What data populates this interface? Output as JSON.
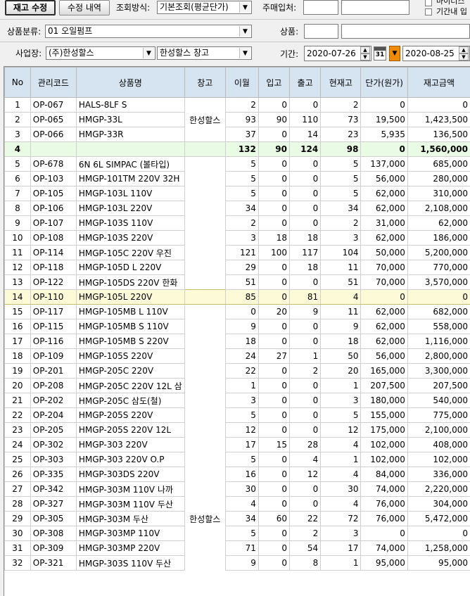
{
  "toolbar": {
    "stock_adjust_label": "재고 수정",
    "edit_history_label": "수정 내역",
    "query_method_label": "조회방식:",
    "query_method_value": "기본조회(평균단가)",
    "main_vendor_label": "주매입처:",
    "my_item_label": "마이너스",
    "period_label_chk": "기간내 입"
  },
  "filters": {
    "category_label": "상품분류:",
    "category_value": "01 오일펌프",
    "product_label": "상품:",
    "business_label": "사업장:",
    "business_value": "(주)한성할스",
    "warehouse_value": "한성할스 창고",
    "period_label": "기간:",
    "date_from": "2020-07-26",
    "date_to": "2020-08-25",
    "calendar_text": "31"
  },
  "grid": {
    "columns": [
      "No",
      "관리코드",
      "상품명",
      "창고",
      "이월",
      "입고",
      "출고",
      "현재고",
      "단가(원가)",
      "재고금액"
    ],
    "group1_warehouse": "한성할스",
    "group2_warehouse": "한성할스",
    "rows": [
      {
        "no": "1",
        "code": "OP-067",
        "name": "HALS-8LF S",
        "carry": "2",
        "in": "0",
        "out": "0",
        "stock": "2",
        "price": "0",
        "amount": "0"
      },
      {
        "no": "2",
        "code": "OP-065",
        "name": "HMGP-33L",
        "carry": "93",
        "in": "90",
        "out": "110",
        "stock": "73",
        "price": "19,500",
        "amount": "1,423,500"
      },
      {
        "no": "3",
        "code": "OP-066",
        "name": "HMGP-33R",
        "carry": "37",
        "in": "0",
        "out": "14",
        "stock": "23",
        "price": "5,935",
        "amount": "136,500"
      },
      {
        "no": "4",
        "code": "",
        "name": "",
        "carry": "132",
        "in": "90",
        "out": "124",
        "stock": "98",
        "price": "0",
        "amount": "1,560,000"
      },
      {
        "no": "5",
        "code": "OP-678",
        "name": "6N 6L SIMPAC (볼타입)",
        "carry": "5",
        "in": "0",
        "out": "0",
        "stock": "5",
        "price": "137,000",
        "amount": "685,000"
      },
      {
        "no": "6",
        "code": "OP-103",
        "name": "HMGP-101TM 220V 32H",
        "carry": "5",
        "in": "0",
        "out": "0",
        "stock": "5",
        "price": "56,000",
        "amount": "280,000"
      },
      {
        "no": "7",
        "code": "OP-105",
        "name": "HMGP-103L 110V",
        "carry": "5",
        "in": "0",
        "out": "0",
        "stock": "5",
        "price": "62,000",
        "amount": "310,000"
      },
      {
        "no": "8",
        "code": "OP-106",
        "name": "HMGP-103L 220V",
        "carry": "34",
        "in": "0",
        "out": "0",
        "stock": "34",
        "price": "62,000",
        "amount": "2,108,000"
      },
      {
        "no": "9",
        "code": "OP-107",
        "name": "HMGP-103S 110V",
        "carry": "2",
        "in": "0",
        "out": "0",
        "stock": "2",
        "price": "31,000",
        "amount": "62,000"
      },
      {
        "no": "10",
        "code": "OP-108",
        "name": "HMGP-103S 220V",
        "carry": "3",
        "in": "18",
        "out": "18",
        "stock": "3",
        "price": "62,000",
        "amount": "186,000"
      },
      {
        "no": "11",
        "code": "OP-114",
        "name": "HMGP-105C 220V 우진",
        "carry": "121",
        "in": "100",
        "out": "117",
        "stock": "104",
        "price": "50,000",
        "amount": "5,200,000"
      },
      {
        "no": "12",
        "code": "OP-118",
        "name": "HMGP-105D L 220V",
        "carry": "29",
        "in": "0",
        "out": "18",
        "stock": "11",
        "price": "70,000",
        "amount": "770,000"
      },
      {
        "no": "13",
        "code": "OP-122",
        "name": "HMGP-105DS 220V 한화",
        "carry": "51",
        "in": "0",
        "out": "0",
        "stock": "51",
        "price": "70,000",
        "amount": "3,570,000"
      },
      {
        "no": "14",
        "code": "OP-110",
        "name": "HMGP-105L 220V",
        "carry": "85",
        "in": "0",
        "out": "81",
        "stock": "4",
        "price": "0",
        "amount": "0"
      },
      {
        "no": "15",
        "code": "OP-117",
        "name": "HMGP-105MB L 110V",
        "carry": "0",
        "in": "20",
        "out": "9",
        "stock": "11",
        "price": "62,000",
        "amount": "682,000"
      },
      {
        "no": "16",
        "code": "OP-115",
        "name": "HMGP-105MB S 110V",
        "carry": "9",
        "in": "0",
        "out": "0",
        "stock": "9",
        "price": "62,000",
        "amount": "558,000"
      },
      {
        "no": "17",
        "code": "OP-116",
        "name": "HMGP-105MB S 220V",
        "carry": "18",
        "in": "0",
        "out": "0",
        "stock": "18",
        "price": "62,000",
        "amount": "1,116,000"
      },
      {
        "no": "18",
        "code": "OP-109",
        "name": "HMGP-105S 220V",
        "carry": "24",
        "in": "27",
        "out": "1",
        "stock": "50",
        "price": "56,000",
        "amount": "2,800,000"
      },
      {
        "no": "19",
        "code": "OP-201",
        "name": "HMGP-205C 220V",
        "carry": "22",
        "in": "0",
        "out": "2",
        "stock": "20",
        "price": "165,000",
        "amount": "3,300,000"
      },
      {
        "no": "20",
        "code": "OP-208",
        "name": "HMGP-205C 220V 12L 삼",
        "carry": "1",
        "in": "0",
        "out": "0",
        "stock": "1",
        "price": "207,500",
        "amount": "207,500"
      },
      {
        "no": "21",
        "code": "OP-202",
        "name": "HMGP-205C 삼도(철)",
        "carry": "3",
        "in": "0",
        "out": "0",
        "stock": "3",
        "price": "180,000",
        "amount": "540,000"
      },
      {
        "no": "22",
        "code": "OP-204",
        "name": "HMGP-205S 220V",
        "carry": "5",
        "in": "0",
        "out": "0",
        "stock": "5",
        "price": "155,000",
        "amount": "775,000"
      },
      {
        "no": "23",
        "code": "OP-205",
        "name": "HMGP-205S 220V 12L",
        "carry": "12",
        "in": "0",
        "out": "0",
        "stock": "12",
        "price": "175,000",
        "amount": "2,100,000"
      },
      {
        "no": "24",
        "code": "OP-302",
        "name": "HMGP-303 220V",
        "carry": "17",
        "in": "15",
        "out": "28",
        "stock": "4",
        "price": "102,000",
        "amount": "408,000"
      },
      {
        "no": "25",
        "code": "OP-303",
        "name": "HMGP-303 220V O.P",
        "carry": "5",
        "in": "0",
        "out": "4",
        "stock": "1",
        "price": "102,000",
        "amount": "102,000"
      },
      {
        "no": "26",
        "code": "OP-335",
        "name": "HMGP-303DS 220V",
        "carry": "16",
        "in": "0",
        "out": "12",
        "stock": "4",
        "price": "84,000",
        "amount": "336,000"
      },
      {
        "no": "27",
        "code": "OP-342",
        "name": "HMGP-303M 110V 나까",
        "carry": "30",
        "in": "0",
        "out": "0",
        "stock": "30",
        "price": "74,000",
        "amount": "2,220,000"
      },
      {
        "no": "28",
        "code": "OP-327",
        "name": "HMGP-303M 110V 두산",
        "carry": "4",
        "in": "0",
        "out": "0",
        "stock": "4",
        "price": "76,000",
        "amount": "304,000"
      },
      {
        "no": "29",
        "code": "OP-305",
        "name": "HMGP-303M 두산",
        "carry": "34",
        "in": "60",
        "out": "22",
        "stock": "72",
        "price": "76,000",
        "amount": "5,472,000"
      },
      {
        "no": "30",
        "code": "OP-308",
        "name": "HMGP-303MP 110V",
        "carry": "5",
        "in": "0",
        "out": "2",
        "stock": "3",
        "price": "0",
        "amount": "0"
      },
      {
        "no": "31",
        "code": "OP-309",
        "name": "HMGP-303MP 220V",
        "carry": "71",
        "in": "0",
        "out": "54",
        "stock": "17",
        "price": "74,000",
        "amount": "1,258,000"
      },
      {
        "no": "32",
        "code": "OP-321",
        "name": "HMGP-303S 110V 두산",
        "carry": "9",
        "in": "0",
        "out": "8",
        "stock": "1",
        "price": "95,000",
        "amount": "95,000"
      }
    ]
  }
}
